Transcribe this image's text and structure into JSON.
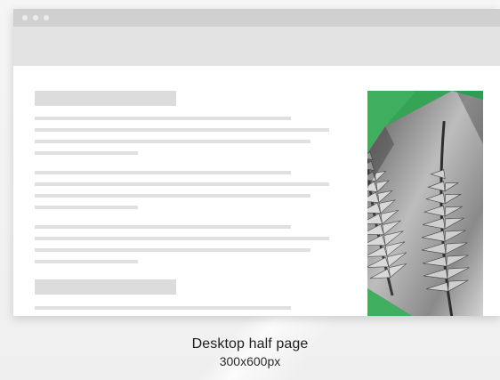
{
  "caption": {
    "title": "Desktop half page",
    "size": "300x600px"
  },
  "ad_banner": {
    "accent_color": "#3fae5f",
    "image": "fern-leaves-photo"
  },
  "colors": {
    "background": "#f3f3f3",
    "titlebar": "#d0d0d0",
    "toolbar": "#e3e3e3",
    "placeholder": "#dedede"
  }
}
